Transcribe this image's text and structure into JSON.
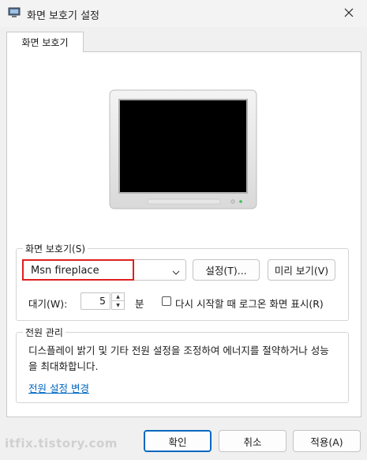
{
  "window": {
    "title": "화면 보호기 설정",
    "close_icon": "×"
  },
  "tab": {
    "label": "화면 보호기"
  },
  "screensaver_group": {
    "label": "화면 보호기(S)",
    "selected": "Msn fireplace",
    "settings_button": "설정(T)...",
    "preview_button": "미리 보기(V)",
    "wait_label": "대기(W):",
    "wait_value": "5",
    "wait_unit": "분",
    "logon_checkbox_label": "다시 시작할 때 로그온 화면 표시(R)",
    "logon_checked": false
  },
  "power_group": {
    "label": "전원 관리",
    "description": "디스플레이 밝기 및 기타 전원 설정을 조정하여 에너지를 절약하거나 성능을 최대화합니다.",
    "link": "전원 설정 변경"
  },
  "footer": {
    "ok": "확인",
    "cancel": "취소",
    "apply": "적용(A)"
  },
  "watermark": "itfix.tistory.com",
  "colors": {
    "accent": "#0067c0",
    "highlight": "#e02020",
    "monitor_screen": "#000000"
  }
}
